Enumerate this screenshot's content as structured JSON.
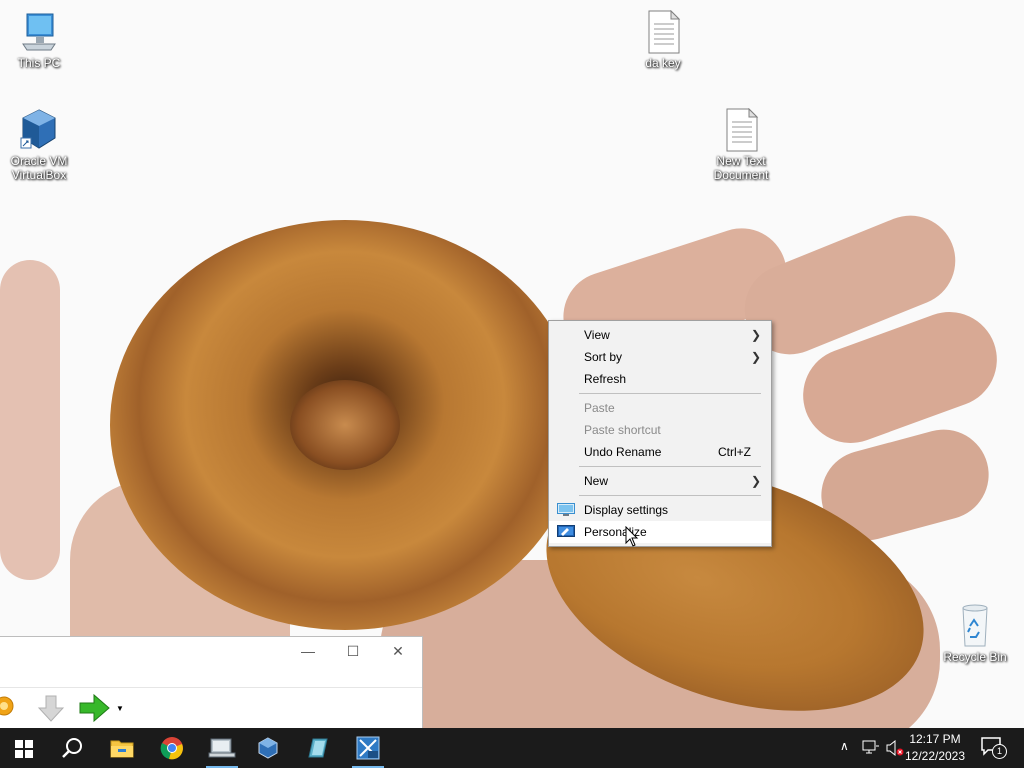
{
  "desktop": {
    "icons": [
      {
        "label": "This PC"
      },
      {
        "label": "da key"
      },
      {
        "label": "Oracle VM VirtualBox"
      },
      {
        "label": "New Text Document"
      },
      {
        "label": "Recycle Bin"
      }
    ]
  },
  "context_menu": {
    "items": [
      {
        "label": "View",
        "submenu": true
      },
      {
        "label": "Sort by",
        "submenu": true
      },
      {
        "label": "Refresh"
      },
      {
        "label": "Paste",
        "disabled": true
      },
      {
        "label": "Paste shortcut",
        "disabled": true
      },
      {
        "label": "Undo Rename",
        "shortcut": "Ctrl+Z"
      },
      {
        "label": "New",
        "submenu": true
      },
      {
        "label": "Display settings",
        "icon": "display-settings-icon"
      },
      {
        "label": "Personalize",
        "icon": "personalize-icon",
        "highlighted": true
      }
    ]
  },
  "window": {
    "minimize_glyph": "—",
    "maximize_glyph": "☐",
    "close_glyph": "✕"
  },
  "taskbar": {
    "pinned": [
      {
        "name": "start-icon"
      },
      {
        "name": "search-icon"
      },
      {
        "name": "file-explorer-icon"
      },
      {
        "name": "chrome-icon"
      },
      {
        "name": "control-panel-icon",
        "active": true
      },
      {
        "name": "virtualbox-icon"
      },
      {
        "name": "app-icon"
      },
      {
        "name": "server-2000-icon",
        "active": true
      }
    ],
    "tray": {
      "time": "12:17 PM",
      "date": "12/22/2023",
      "notification_count": "1"
    }
  },
  "colors": {
    "taskbar": "#1b1b1b",
    "menu_bg": "#f2f2f2",
    "accent": "#76b9ed"
  }
}
